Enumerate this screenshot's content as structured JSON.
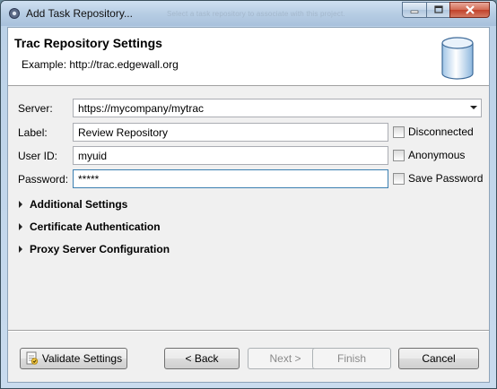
{
  "window": {
    "title": "Add Task Repository...",
    "ghost_text": "Select a task repository to associate with this project."
  },
  "header": {
    "title": "Trac Repository Settings",
    "description": "Example: http://trac.edgewall.org"
  },
  "form": {
    "server_label": "Server:",
    "server_value": "https://mycompany/mytrac",
    "label_label": "Label:",
    "label_value": "Review Repository",
    "userid_label": "User ID:",
    "userid_value": "myuid",
    "password_label": "Password:",
    "password_value": "*****",
    "disconnected_label": "Disconnected",
    "anonymous_label": "Anonymous",
    "save_password_label": "Save Password"
  },
  "sections": [
    "Additional Settings",
    "Certificate Authentication",
    "Proxy Server Configuration"
  ],
  "buttons": {
    "validate": "Validate Settings",
    "back": "< Back",
    "next": "Next >",
    "finish": "Finish",
    "cancel": "Cancel"
  }
}
